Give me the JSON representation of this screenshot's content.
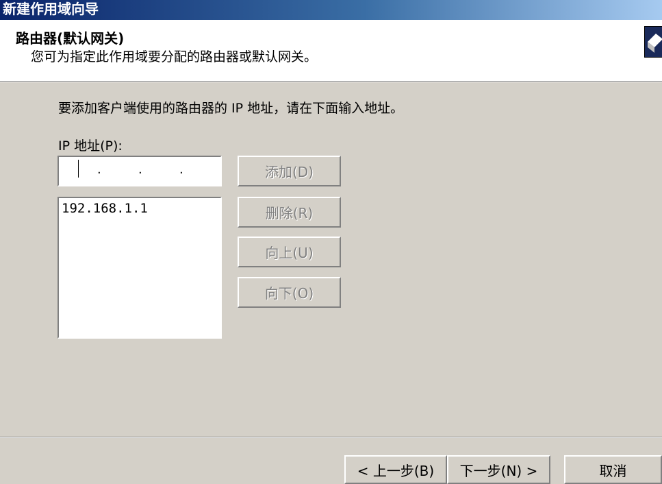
{
  "window": {
    "title": "新建作用域向导"
  },
  "header": {
    "title": "路由器(默认网关)",
    "subtitle": "您可为指定此作用域要分配的路由器或默认网关。"
  },
  "main": {
    "instruction": "要添加客户端使用的路由器的 IP 地址，请在下面输入地址。",
    "ip_label": "IP 地址(P):",
    "ip_input": {
      "value": "",
      "dots": [
        ".",
        ".",
        "."
      ]
    },
    "router_list": [
      "192.168.1.1"
    ],
    "buttons": {
      "add": "添加(D)",
      "remove": "删除(R)",
      "up": "向上(U)",
      "down": "向下(O)"
    }
  },
  "footer": {
    "back": "< 上一步(B)",
    "next": "下一步(N) >",
    "cancel": "取消"
  },
  "colors": {
    "title_gradient_start": "#0a246a",
    "title_gradient_end": "#a6caf0",
    "face": "#d4d0c8"
  }
}
